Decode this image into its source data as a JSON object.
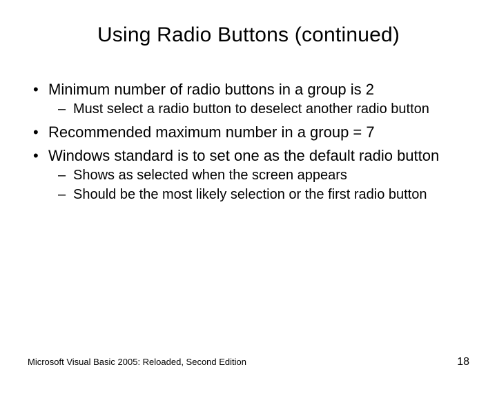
{
  "title": "Using Radio Buttons (continued)",
  "bullets": {
    "b1": "Minimum number of radio buttons in a group is 2",
    "b1_sub1": "Must select a radio button to deselect another radio button",
    "b2": "Recommended maximum number in a group = 7",
    "b3": "Windows standard is to set one as the default radio button",
    "b3_sub1": "Shows as selected when the screen appears",
    "b3_sub2": "Should be the most likely selection or the first radio button"
  },
  "footer": {
    "source": "Microsoft Visual Basic 2005: Reloaded, Second Edition",
    "page": "18"
  }
}
